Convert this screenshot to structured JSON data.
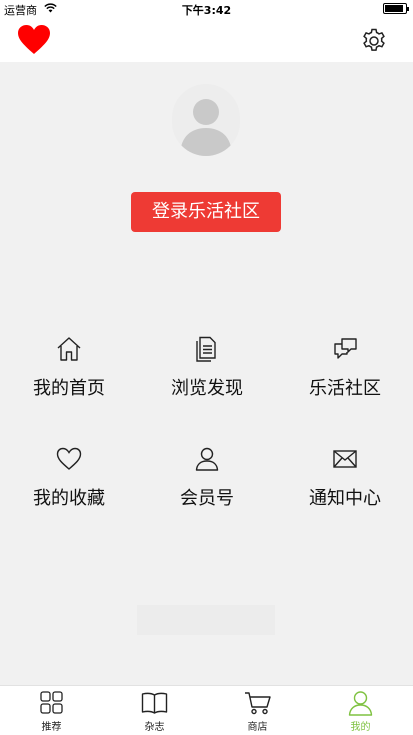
{
  "status_bar": {
    "carrier": "运营商",
    "time": "下午3:42",
    "battery_level": 0.9
  },
  "nav": {
    "left_icon": "heart-icon",
    "right_icon": "gear-icon",
    "accent": "#ff0000"
  },
  "profile": {
    "avatar_icon": "user-avatar-icon",
    "login_label": "登录乐活社区",
    "login_color": "#ee3a34"
  },
  "menu": [
    {
      "label": "我的首页",
      "icon": "home-icon"
    },
    {
      "label": "浏览发现",
      "icon": "document-icon"
    },
    {
      "label": "乐活社区",
      "icon": "chat-bubbles-icon"
    },
    {
      "label": "我的收藏",
      "icon": "heart-outline-icon"
    },
    {
      "label": "会员号",
      "icon": "person-icon"
    },
    {
      "label": "通知中心",
      "icon": "mail-icon"
    }
  ],
  "tabs": [
    {
      "label": "推荐",
      "icon": "grid-icon",
      "active": false
    },
    {
      "label": "杂志",
      "icon": "book-icon",
      "active": false
    },
    {
      "label": "商店",
      "icon": "cart-icon",
      "active": false
    },
    {
      "label": "我的",
      "icon": "user-icon",
      "active": true
    }
  ],
  "colors": {
    "tab_active": "#7fc241",
    "background": "#f1f1f1"
  }
}
